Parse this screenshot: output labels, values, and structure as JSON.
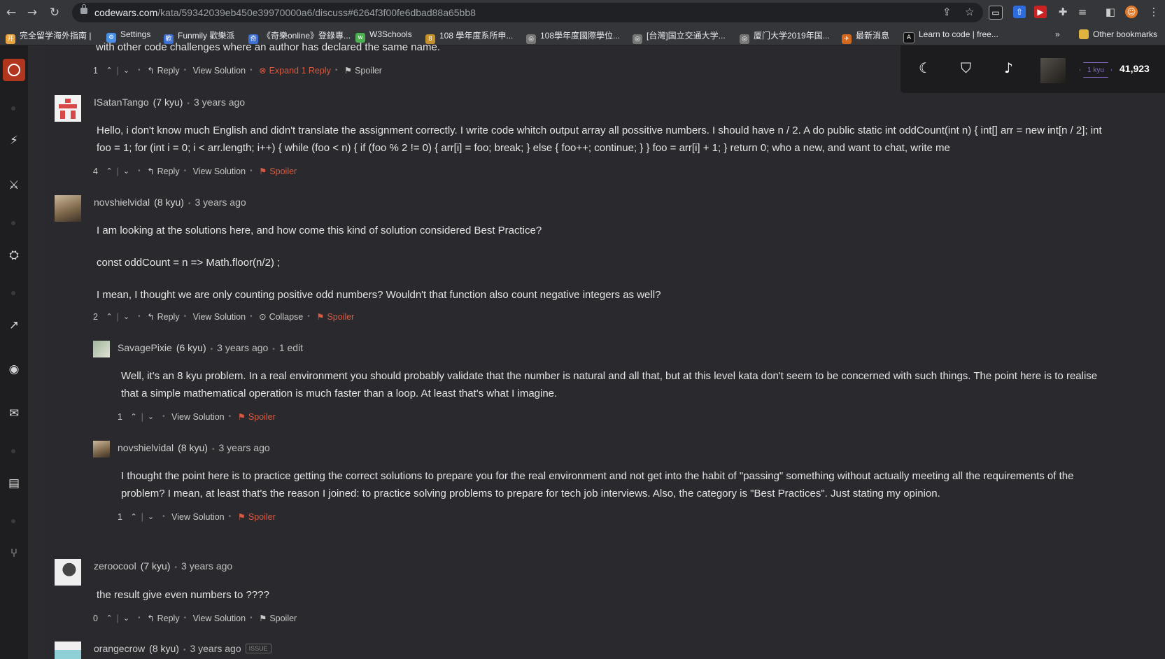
{
  "browser": {
    "url_host": "codewars.com",
    "url_path": "/kata/59342039eb450e39970000a6/discuss#6264f3f00fe6dbad88a65bb8",
    "bookmarks": [
      {
        "label": "完全留学海外指南 |",
        "color": "#e8a33d",
        "glyph": "开"
      },
      {
        "label": "Settings",
        "color": "#4a8fe7",
        "glyph": "⚙"
      },
      {
        "label": "Funmily 歡樂派",
        "color": "#3b6fd1",
        "glyph": "歡"
      },
      {
        "label": "《奇樂online》登錄專...",
        "color": "#3b6fd1",
        "glyph": "奇"
      },
      {
        "label": "W3Schools",
        "color": "#4caf50",
        "glyph": "w"
      },
      {
        "label": "108 學年度系所申...",
        "color": "#c4902c",
        "glyph": "8"
      },
      {
        "label": "108學年度國際學位...",
        "color": "#777",
        "glyph": "◎"
      },
      {
        "label": "[台灣]国立交通大学...",
        "color": "#777",
        "glyph": "◎"
      },
      {
        "label": "厦门大学2019年国...",
        "color": "#777",
        "glyph": "◎"
      },
      {
        "label": "最新消息",
        "color": "#d2691e",
        "glyph": "✈"
      },
      {
        "label": "Learn to code | free...",
        "color": "#111",
        "glyph": "⟨A⟩"
      }
    ],
    "bookmarks_more": "»",
    "other_bookmarks": "Other bookmarks"
  },
  "header": {
    "rank": "1 kyu",
    "honor": "41,923"
  },
  "comments": [
    {
      "text": "with other code challenges where an author has declared the same name.",
      "votes": "1",
      "reply": "Reply",
      "view_solution": "View Solution",
      "expand": "Expand 1 Reply",
      "spoiler": "Spoiler"
    },
    {
      "author": "ISatanTango",
      "kyu": "(7 kyu)",
      "ago": "3 years ago",
      "lines": [
        "Hello, i don't know much English and didn't translate the assignment correctly. I write code whitch output array all possitive numbers. I should have n / 2. A do public static int oddCount(int n) { int[] arr = new int[n / 2]; int",
        "foo = 1; for (int i = 0; i < arr.length; i++) { while (foo < n) { if (foo % 2 != 0) { arr[i] = foo; break; } else { foo++; continue; } } foo = arr[i] + 1; } return 0; who a new, and want to chat, write me"
      ],
      "votes": "4",
      "reply": "Reply",
      "view_solution": "View Solution",
      "spoiler": "Spoiler"
    },
    {
      "author": "novshielvidal",
      "kyu": "(8 kyu)",
      "ago": "3 years ago",
      "p1": "I am looking at the solutions here, and how come this kind of solution considered Best Practice?",
      "p2": "const oddCount = n => Math.floor(n/2) ;",
      "p3": "I mean, I thought we are only counting positive odd numbers? Wouldn't that function also count negative integers as well?",
      "votes": "2",
      "reply": "Reply",
      "view_solution": "View Solution",
      "collapse": "Collapse",
      "spoiler": "Spoiler"
    },
    {
      "author": "SavagePixie",
      "kyu": "(6 kyu)",
      "ago": "3 years ago",
      "edit": "1 edit",
      "lines": [
        "Well, it's an 8 kyu problem. In a real environment you should probably validate that the number is natural and all that, but at this level kata don't seem to be concerned with such things. The point here is to realise",
        "that a simple mathematical operation is much faster than a loop. At least that's what I imagine."
      ],
      "votes": "1",
      "view_solution": "View Solution",
      "spoiler": "Spoiler"
    },
    {
      "author": "novshielvidal",
      "kyu": "(8 kyu)",
      "ago": "3 years ago",
      "lines": [
        "I thought the point here is to practice getting the correct solutions to prepare you for the real environment and not get into the habit of \"passing\" something without actually meeting all the requirements of the",
        "problem? I mean, at least that's the reason I joined: to practice solving problems to prepare for tech job interviews. Also, the category is \"Best Practices\". Just stating my opinion."
      ],
      "votes": "1",
      "view_solution": "View Solution",
      "spoiler": "Spoiler"
    },
    {
      "author": "zeroocool",
      "kyu": "(7 kyu)",
      "ago": "3 years ago",
      "text": "the result give even numbers to ????",
      "votes": "0",
      "reply": "Reply",
      "view_solution": "View Solution",
      "spoiler": "Spoiler"
    },
    {
      "author": "orangecrow",
      "kyu": "(8 kyu)",
      "ago": "3 years ago",
      "tag": "ISSUE"
    }
  ]
}
